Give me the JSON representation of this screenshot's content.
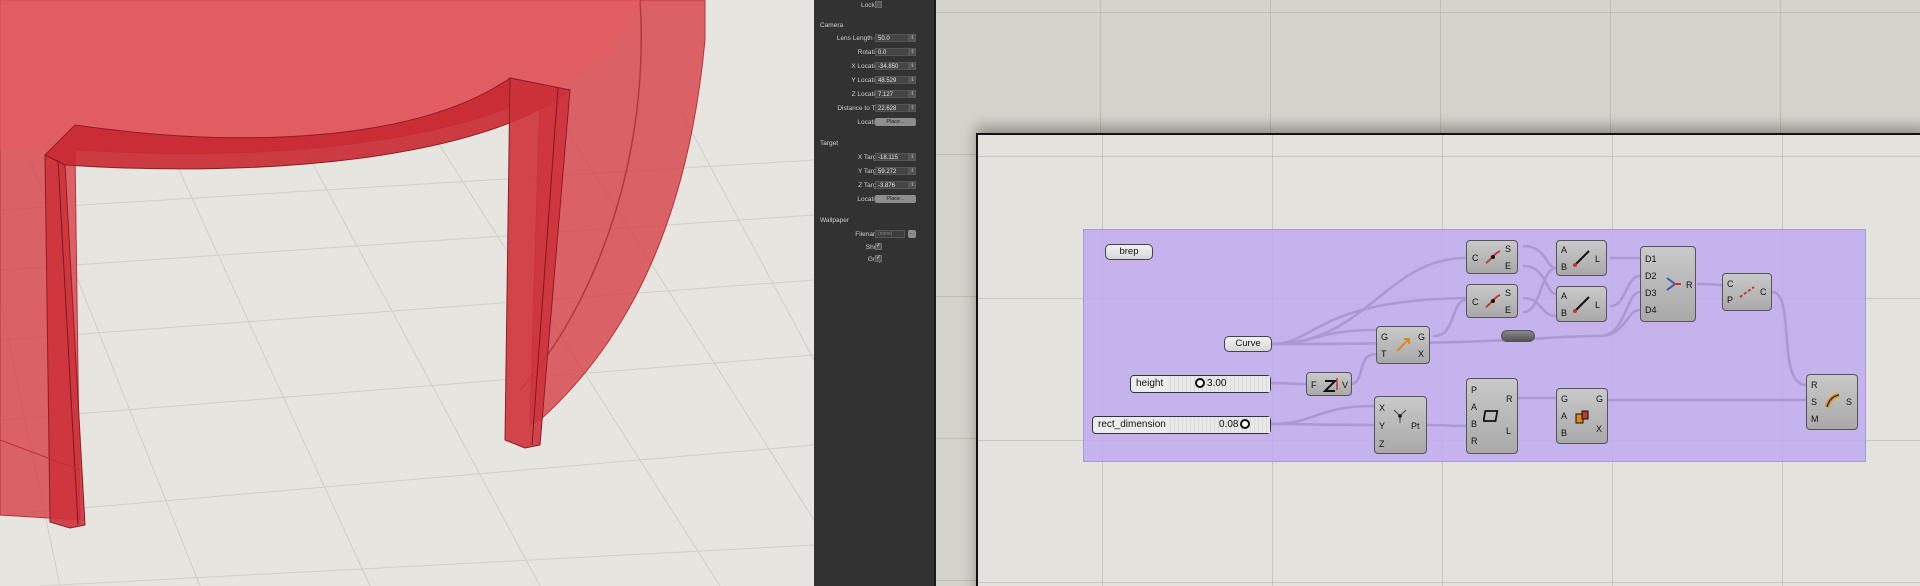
{
  "panel": {
    "locked_label": "Locked",
    "camera_heading": "Camera",
    "camera_fields": [
      {
        "label": "Lens Length (m",
        "value": "50.0"
      },
      {
        "label": "Rotation",
        "value": "0.0"
      },
      {
        "label": "X Location",
        "value": "-34.850"
      },
      {
        "label": "Y Location",
        "value": "48.529"
      },
      {
        "label": "Z Location",
        "value": "7.127"
      },
      {
        "label": "Distance to Tar.",
        "value": "22.628"
      }
    ],
    "camera_location_label": "Location",
    "camera_place_button": "Place...",
    "target_heading": "Target",
    "target_fields": [
      {
        "label": "X Target",
        "value": "-18.115"
      },
      {
        "label": "Y Target",
        "value": "59.272"
      },
      {
        "label": "Z Target",
        "value": "-3.876"
      }
    ],
    "target_location_label": "Location",
    "target_place_button": "Place...",
    "wallpaper_heading": "Wallpaper",
    "filename_label": "Filename",
    "filename_value": "(none)",
    "filename_button": "...",
    "show_label": "Show",
    "gray_label": "Gray",
    "show_checked": true,
    "gray_checked": true
  },
  "canvas": {
    "brep_param": "brep",
    "curve_param": "Curve",
    "height_slider": {
      "label": "height",
      "value": "3.00"
    },
    "rect_slider": {
      "label": "rect_dimension",
      "value": "0.08"
    },
    "components": {
      "shatter1": {
        "in": [
          "C"
        ],
        "out": [
          "S",
          "E"
        ]
      },
      "shatter2": {
        "in": [
          "C"
        ],
        "out": [
          "S",
          "E"
        ]
      },
      "line1": {
        "in": [
          "A",
          "B"
        ],
        "out": [
          "L"
        ]
      },
      "line2": {
        "in": [
          "A",
          "B"
        ],
        "out": [
          "L"
        ]
      },
      "merge": {
        "in": [
          "D1",
          "D2",
          "D3",
          "D4"
        ],
        "out": [
          "R"
        ]
      },
      "pipe": {
        "in": [
          "C",
          "P"
        ],
        "out": [
          "C"
        ]
      },
      "move": {
        "in": [
          "G",
          "T"
        ],
        "out": [
          "G",
          "X"
        ]
      },
      "fz": {
        "in": [
          "F"
        ],
        "out": [
          "V"
        ]
      },
      "construct_point": {
        "in": [
          "X",
          "Y",
          "Z"
        ],
        "out": [
          "Pt"
        ]
      },
      "rectangle": {
        "in": [
          "P",
          "A",
          "B",
          "R"
        ],
        "out": [
          "R",
          "L"
        ]
      },
      "boundary": {
        "in": [
          "G",
          "A",
          "B"
        ],
        "out": [
          "G",
          "X"
        ]
      },
      "sweep": {
        "in": [
          "R",
          "S",
          "M"
        ],
        "out": [
          "S"
        ]
      }
    }
  },
  "colors": {
    "group_fill": "#bfaaf0",
    "model_red": "#d9454a",
    "panel_bg": "#323232"
  }
}
